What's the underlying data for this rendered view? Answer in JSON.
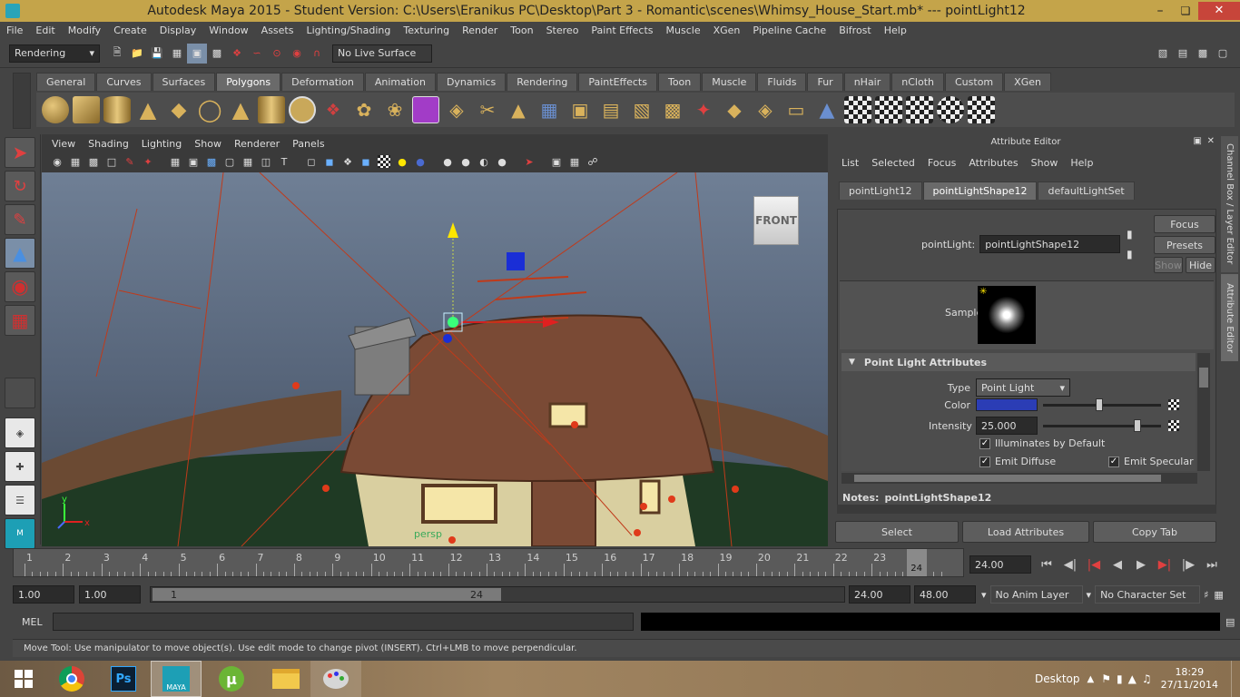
{
  "window": {
    "title": "Autodesk Maya 2015 - Student Version: C:\\Users\\Eranikus PC\\Desktop\\Part 3 - Romantic\\scenes\\Whimsy_House_Start.mb*    ---    pointLight12"
  },
  "menubar": [
    "File",
    "Edit",
    "Modify",
    "Create",
    "Display",
    "Window",
    "Assets",
    "Lighting/Shading",
    "Texturing",
    "Render",
    "Toon",
    "Stereo",
    "Paint Effects",
    "Muscle",
    "XGen",
    "Pipeline Cache",
    "Bifrost",
    "Help"
  ],
  "statusline": {
    "menuset": "Rendering",
    "live_surface": "No Live Surface"
  },
  "shelf_tabs": [
    "General",
    "Curves",
    "Surfaces",
    "Polygons",
    "Deformation",
    "Animation",
    "Dynamics",
    "Rendering",
    "PaintEffects",
    "Toon",
    "Muscle",
    "Fluids",
    "Fur",
    "nHair",
    "nCloth",
    "Custom",
    "XGen"
  ],
  "shelf_active": "Polygons",
  "panel_menu": [
    "View",
    "Shading",
    "Lighting",
    "Show",
    "Renderer",
    "Panels"
  ],
  "viewcube": {
    "label": "FRONT"
  },
  "attr_editor": {
    "title": "Attribute Editor",
    "menu": [
      "List",
      "Selected",
      "Focus",
      "Attributes",
      "Show",
      "Help"
    ],
    "tabs": [
      "pointLight12",
      "pointLightShape12",
      "defaultLightSet"
    ],
    "active_tab": "pointLightShape12",
    "node_label": "pointLight:",
    "node_value": "pointLightShape12",
    "buttons": {
      "focus": "Focus",
      "presets": "Presets",
      "show": "Show",
      "hide": "Hide"
    },
    "sample_label": "Sample",
    "section_title": "Point Light Attributes",
    "type_label": "Type",
    "type_value": "Point Light",
    "color_label": "Color",
    "color_hex": "#2b3db5",
    "intensity_label": "Intensity",
    "intensity_value": "25.000",
    "illuminates": "Illuminates by Default",
    "emit_diffuse": "Emit Diffuse",
    "emit_specular": "Emit Specular",
    "notes_label": "Notes:",
    "notes_value": "pointLightShape12",
    "bottom_buttons": {
      "select": "Select",
      "load": "Load Attributes",
      "copy": "Copy Tab"
    }
  },
  "side_tabs": {
    "channel_box": "Channel Box / Layer Editor",
    "attribute_editor": "Attribute Editor"
  },
  "timeline": {
    "ticks": [
      "1",
      "2",
      "3",
      "4",
      "5",
      "6",
      "7",
      "8",
      "9",
      "10",
      "11",
      "12",
      "13",
      "14",
      "15",
      "16",
      "17",
      "18",
      "19",
      "20",
      "21",
      "22",
      "23",
      "24"
    ],
    "current_frame": "24",
    "current_frame_field": "24.00"
  },
  "range": {
    "start": "1.00",
    "anim_start": "1.00",
    "slider_left": "1",
    "slider_right": "24",
    "anim_end": "24.00",
    "end": "48.00",
    "anim_layer": "No Anim Layer",
    "char_set": "No Character Set"
  },
  "cmdline": {
    "label": "MEL"
  },
  "helpline": "Move Tool: Use manipulator to move object(s). Use edit mode to change pivot (INSERT).  Ctrl+LMB to move perpendicular.",
  "taskbar": {
    "desktop": "Desktop",
    "time": "18:29",
    "date": "27/11/2014"
  },
  "viewport": {
    "persp_label": "persp"
  }
}
